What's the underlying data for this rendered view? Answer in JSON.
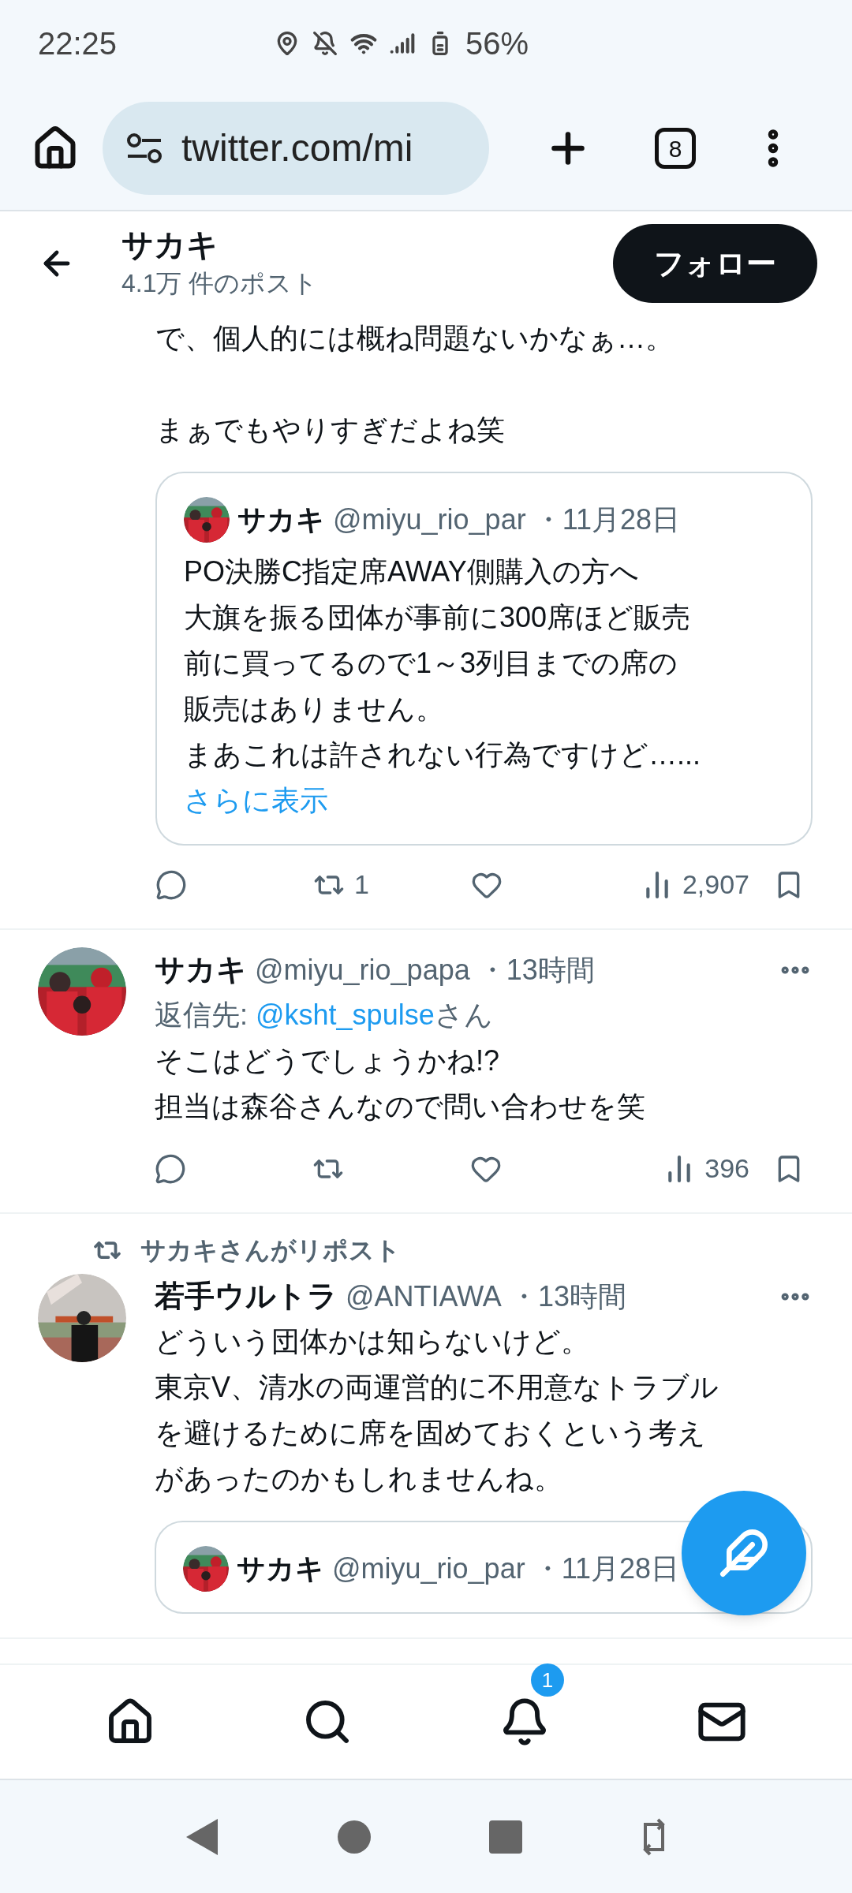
{
  "status_bar": {
    "time": "22:25",
    "battery": "56%"
  },
  "browser": {
    "url": "twitter.com/mi",
    "tab_count": "8"
  },
  "header": {
    "name": "サカキ",
    "post_count": "4.1万 件のポスト",
    "follow_button": "フォロー"
  },
  "posts": [
    {
      "kind": "continued",
      "text": [
        [
          "で、個人的には概ね問題ないかなぁ…。"
        ],
        [
          "まぁでもやりすぎだよね笑"
        ]
      ],
      "quote": {
        "name": "サカキ",
        "handle": "@miyu_rio_par",
        "time": "・11月28日",
        "text": [
          "PO決勝C指定席AWAY側購入の方へ",
          "大旗を振る団体が事前に300席ほど販売",
          "前に買ってるので1～3列目までの席の",
          "販売はありません。",
          "まあこれは許されない行為ですけど…..."
        ],
        "more": "さらに表示"
      },
      "actions": [
        {
          "kind": "reply"
        },
        {
          "kind": "repost",
          "count": "1"
        },
        {
          "kind": "like"
        },
        {
          "kind": "views",
          "count": "2,907"
        },
        {
          "kind": "bookmark"
        }
      ]
    },
    {
      "kind": "reply",
      "name": "サカキ",
      "handle": "@miyu_rio_papa",
      "time": "・13時間",
      "reply_to": {
        "prefix": "返信先: ",
        "handle": "@ksht_spulse",
        "suffix": "さん"
      },
      "text": [
        [
          "そこはどうでしょうかね!?",
          "担当は森谷さんなので問い合わせを笑"
        ]
      ],
      "actions": [
        {
          "kind": "reply"
        },
        {
          "kind": "repost"
        },
        {
          "kind": "like"
        },
        {
          "kind": "views",
          "count": "396"
        },
        {
          "kind": "bookmark"
        }
      ]
    },
    {
      "kind": "repost",
      "repost_label": "サカキさんがリポスト",
      "name": "若手ウルトラ",
      "handle": "@ANTIAWA",
      "time": "・13時間",
      "text": [
        [
          "どういう団体かは知らないけど。",
          "東京V、清水の両運営的に不用意なトラブル",
          "を避けるために席を固めておくという考え",
          "があったのかもしれませんね。"
        ]
      ],
      "quote": {
        "name": "サカキ",
        "handle": "@miyu_rio_par",
        "time": "・11月28日"
      }
    }
  ],
  "bottom_nav": [
    {
      "kind": "home"
    },
    {
      "kind": "search"
    },
    {
      "kind": "notifications",
      "badge": "1"
    },
    {
      "kind": "messages"
    }
  ]
}
